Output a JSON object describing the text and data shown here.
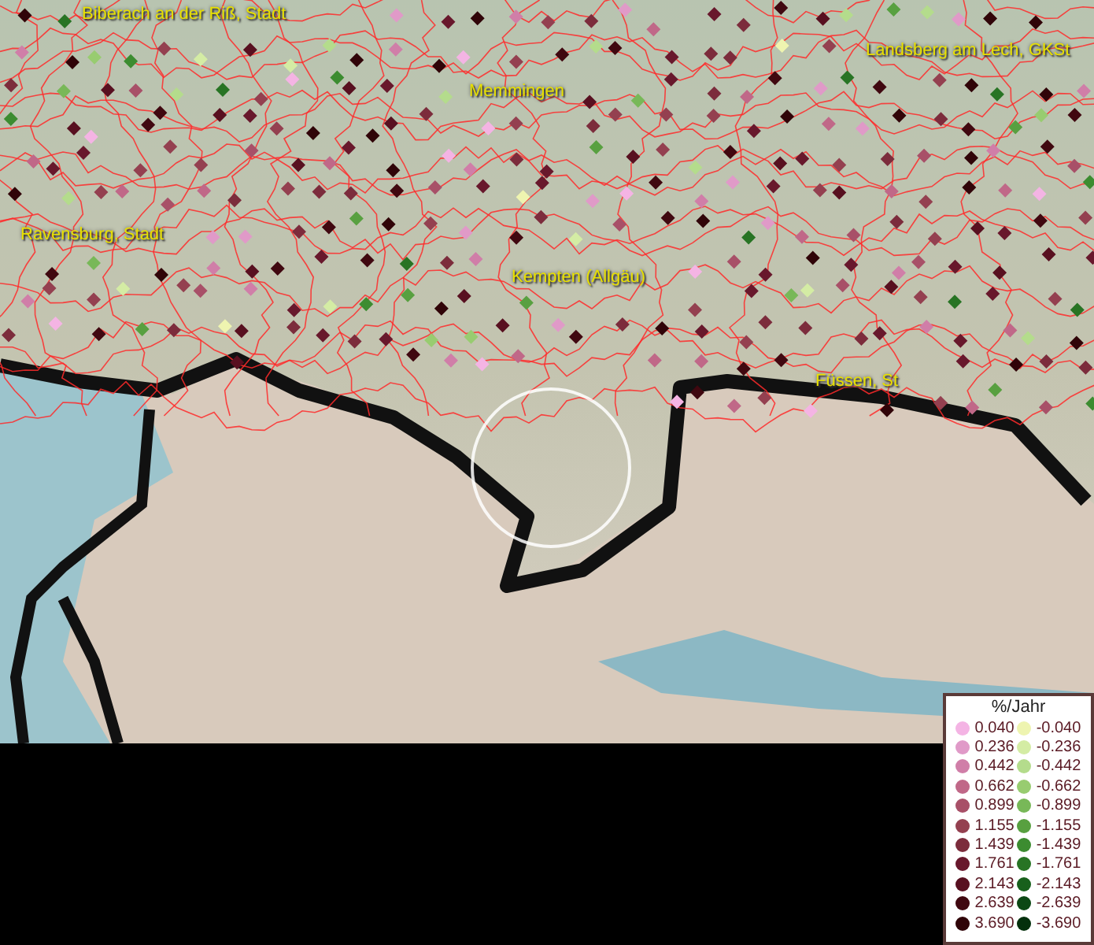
{
  "map": {
    "place_labels": [
      "Biberach an der Riß, Stadt",
      "Memmingen",
      "Landsberg am Lech, GKSt",
      "Ravensburg, Stadt",
      "Kempten (Allgäu)",
      "Füssen, St"
    ]
  },
  "legend": {
    "title": "%/Jahr",
    "increase": [
      {
        "label": "0.040",
        "color": "#f4b4e4"
      },
      {
        "label": "0.236",
        "color": "#e09ac8"
      },
      {
        "label": "0.442",
        "color": "#d07ea8"
      },
      {
        "label": "0.662",
        "color": "#c06888"
      },
      {
        "label": "0.899",
        "color": "#a85068"
      },
      {
        "label": "1.155",
        "color": "#944050"
      },
      {
        "label": "1.439",
        "color": "#7c2c3c"
      },
      {
        "label": "1.761",
        "color": "#68182c"
      },
      {
        "label": "2.143",
        "color": "#581020"
      },
      {
        "label": "2.639",
        "color": "#400810"
      },
      {
        "label": "3.690",
        "color": "#300408"
      }
    ],
    "decrease": [
      {
        "label": "-0.040",
        "color": "#eef4b0"
      },
      {
        "label": "-0.236",
        "color": "#d4eca4"
      },
      {
        "label": "-0.442",
        "color": "#b4dc8c"
      },
      {
        "label": "-0.662",
        "color": "#98cc70"
      },
      {
        "label": "-0.899",
        "color": "#78b858"
      },
      {
        "label": "-1.155",
        "color": "#58a040"
      },
      {
        "label": "-1.439",
        "color": "#3c8c30"
      },
      {
        "label": "-1.761",
        "color": "#287424"
      },
      {
        "label": "-2.143",
        "color": "#18601c"
      },
      {
        "label": "-2.639",
        "color": "#0c4814"
      },
      {
        "label": "-3.690",
        "color": "#04300c"
      }
    ]
  }
}
